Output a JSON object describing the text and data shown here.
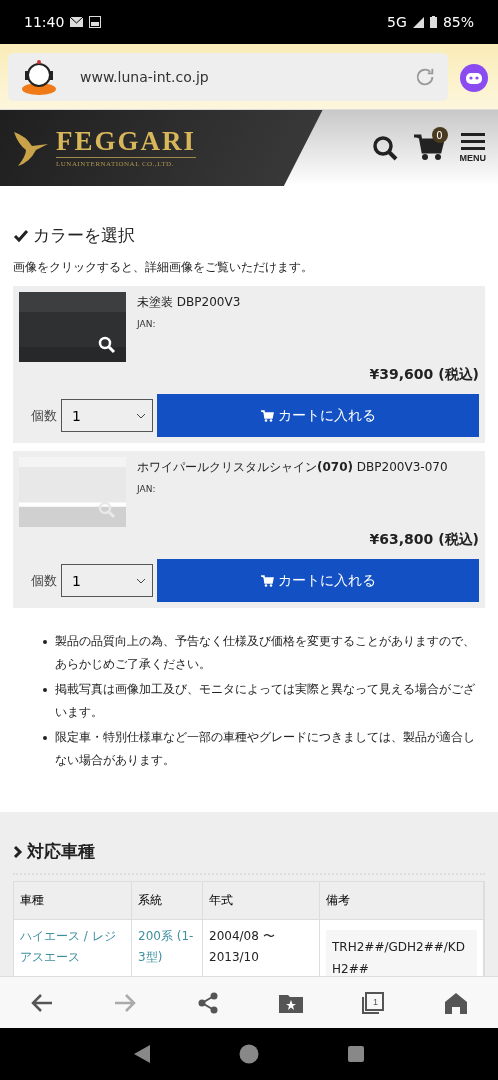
{
  "status_bar": {
    "time": "11:40",
    "network": "5G",
    "battery": "85%"
  },
  "browser": {
    "url": "www.luna-int.co.jp"
  },
  "header": {
    "brand": "FEGGARI",
    "tagline": "LUNAINTERNATIONAL CO.,LTD.",
    "cart_count": "0",
    "menu_label": "MENU"
  },
  "color_section": {
    "title": "カラーを選択",
    "hint": "画像をクリックすると、詳細画像をご覧いただけます。",
    "products": [
      {
        "name": "未塗装",
        "code": "DBP200V3",
        "jan": "JAN:",
        "price": "¥39,600 (税込)",
        "qty_label": "個数",
        "quantity": "1",
        "cart_button": "カートに入れる"
      },
      {
        "name": "ホワイパールクリスタルシャイン**(070)**",
        "code": "DBP200V3-070",
        "jan": "JAN:",
        "price": "¥63,800 (税込)",
        "qty_label": "個数",
        "quantity": "1",
        "cart_button": "カートに入れる"
      }
    ],
    "notes": [
      "製品の品質向上の為、予告なく仕様及び価格を変更することがありますので、あらかじめご了承ください。",
      "掲載写真は画像加工及び、モニタによっては実際と異なって見える場合がございます。",
      "限定車・特別仕様車など一部の車種やグレードにつきましては、製品が適合しない場合があります。"
    ]
  },
  "vehicles": {
    "title": "対応車種",
    "table": {
      "columns": [
        "車種",
        "系統",
        "年式",
        "備考"
      ],
      "rows": [
        [
          "ハイエース / レジアスエース",
          "200系 (1-3型)",
          "2004/08 〜 2013/10",
          "TRH2##/GDH2##/KDH2##"
        ]
      ]
    }
  },
  "bottom_nav": {
    "forward_disabled": true,
    "tab_count": "1"
  }
}
